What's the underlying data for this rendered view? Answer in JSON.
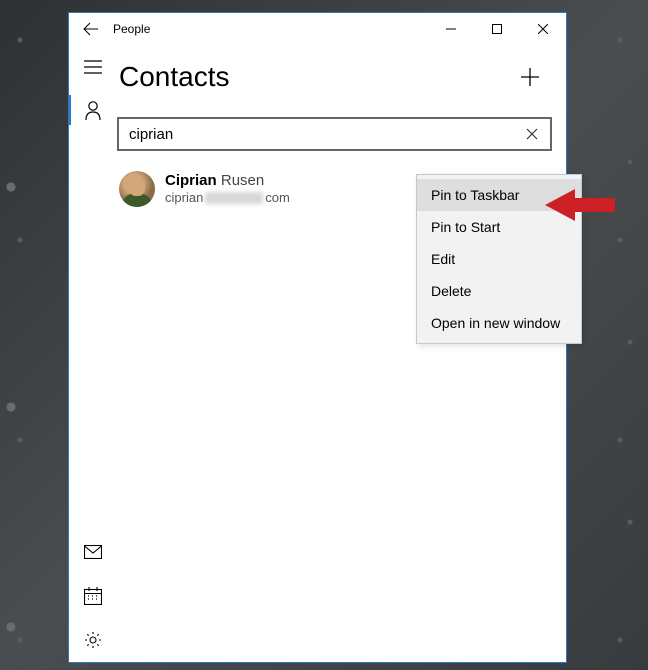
{
  "titlebar": {
    "app_name": "People"
  },
  "page": {
    "title": "Contacts"
  },
  "search": {
    "value": "ciprian"
  },
  "contact": {
    "first_name": "Ciprian",
    "last_name": "Rusen",
    "email_prefix": "ciprian",
    "email_suffix": "com"
  },
  "context_menu": {
    "items": [
      "Pin to Taskbar",
      "Pin to Start",
      "Edit",
      "Delete",
      "Open in new window"
    ]
  }
}
